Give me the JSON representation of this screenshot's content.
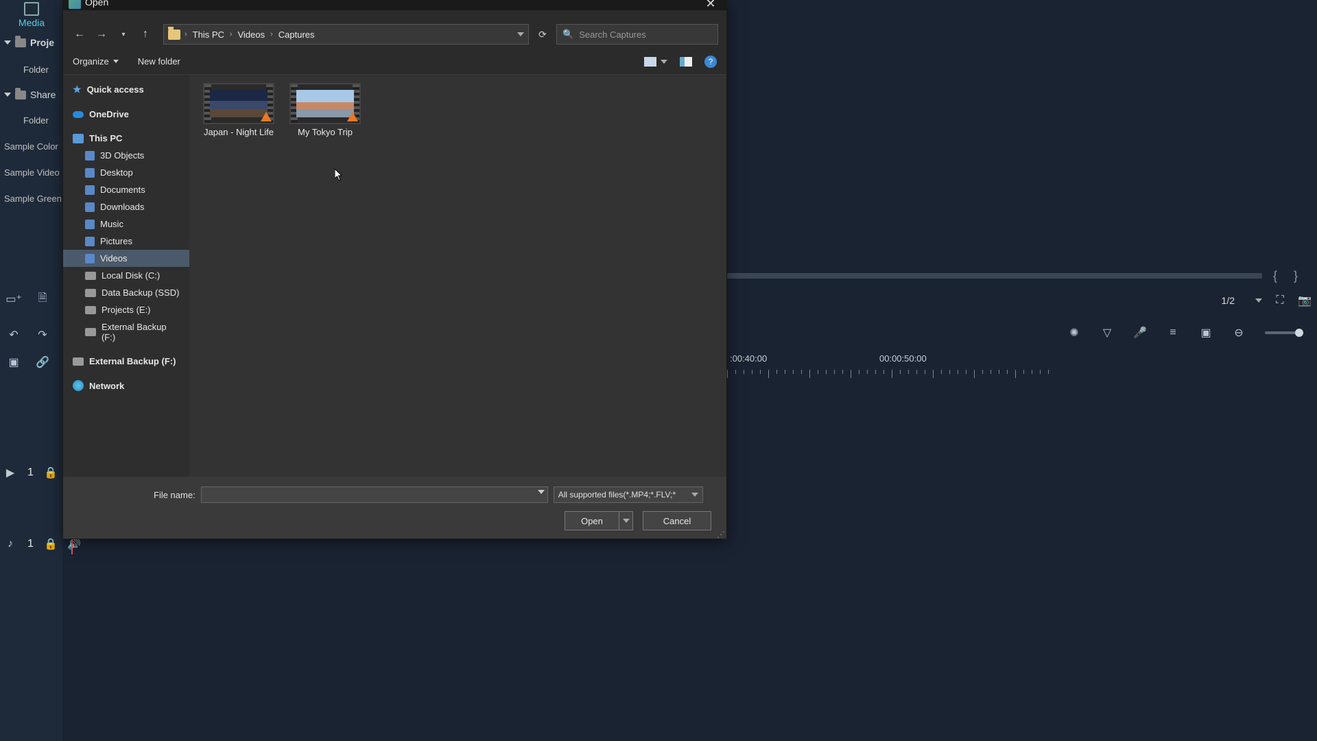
{
  "host": {
    "media_tab": "Media",
    "project_label": "Proje",
    "folder_label": "Folder",
    "shared_label": "Share",
    "items": [
      "Sample Color",
      "Sample Video",
      "Sample Green"
    ],
    "pager": "1/2",
    "timeline": {
      "t1": ":00:40:00",
      "t2": "00:00:50:00"
    },
    "track1_num": "1",
    "track2_num": "1"
  },
  "dialog": {
    "title": "Open",
    "breadcrumb": [
      "This PC",
      "Videos",
      "Captures"
    ],
    "search_placeholder": "Search Captures",
    "organize": "Organize",
    "new_folder": "New folder",
    "tree": {
      "quick_access": "Quick access",
      "onedrive": "OneDrive",
      "this_pc": "This PC",
      "children": [
        "3D Objects",
        "Desktop",
        "Documents",
        "Downloads",
        "Music",
        "Pictures",
        "Videos",
        "Local Disk (C:)",
        "Data Backup (SSD)",
        "Projects (E:)",
        "External Backup (F:)"
      ],
      "ext2": "External Backup (F:)",
      "network": "Network"
    },
    "files": [
      {
        "name": "Japan - Night Life"
      },
      {
        "name": "My Tokyo Trip"
      }
    ],
    "filename_label": "File name:",
    "filter": "All supported files(*.MP4;*.FLV;*",
    "open_btn": "Open",
    "cancel_btn": "Cancel"
  }
}
